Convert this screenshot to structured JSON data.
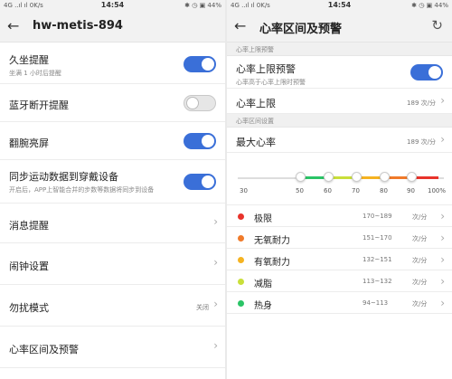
{
  "status": {
    "left_text": "4G ..ıl ıl 0K/s",
    "time": "14:54",
    "right_text": "✱ ◷ ▣ 44%"
  },
  "left": {
    "title": "hw-metis-894",
    "rows": [
      {
        "label": "久坐提醒",
        "sub": "坐满 1 小时后提醒",
        "toggle": "on"
      },
      {
        "label": "蓝牙断开提醒",
        "toggle": "off"
      },
      {
        "label": "翻腕亮屏",
        "toggle": "on"
      },
      {
        "label": "同步运动数据到穿戴设备",
        "sub": "开启后，APP上智能合并的步数等数据将同步到设备",
        "toggle": "on"
      },
      {
        "label": "消息提醒"
      },
      {
        "label": "闹钟设置"
      },
      {
        "label": "勿扰模式",
        "value": "关闭"
      },
      {
        "label": "心率区间及预警"
      }
    ]
  },
  "right": {
    "title": "心率区间及预警",
    "upper_section": "心率上限预警",
    "upper_alert": {
      "label": "心率上限预警",
      "sub": "心率高于心率上限时预警",
      "toggle": "on"
    },
    "upper_limit": {
      "label": "心率上限",
      "value": "189 次/分"
    },
    "range_section": "心率区间设置",
    "max_hr": {
      "label": "最大心率",
      "value": "189 次/分"
    },
    "scale_ticks": [
      "30",
      "50",
      "60",
      "70",
      "80",
      "90",
      "100%"
    ],
    "zones": [
      {
        "name": "极限",
        "range": "170~189",
        "unit": "次/分",
        "color": "#e8332b"
      },
      {
        "name": "无氧耐力",
        "range": "151~170",
        "unit": "次/分",
        "color": "#f07a2a"
      },
      {
        "name": "有氧耐力",
        "range": "132~151",
        "unit": "次/分",
        "color": "#f5b321"
      },
      {
        "name": "减脂",
        "range": "113~132",
        "unit": "次/分",
        "color": "#c9df3a"
      },
      {
        "name": "热身",
        "range": "94~113",
        "unit": "次/分",
        "color": "#2ac466"
      }
    ]
  }
}
